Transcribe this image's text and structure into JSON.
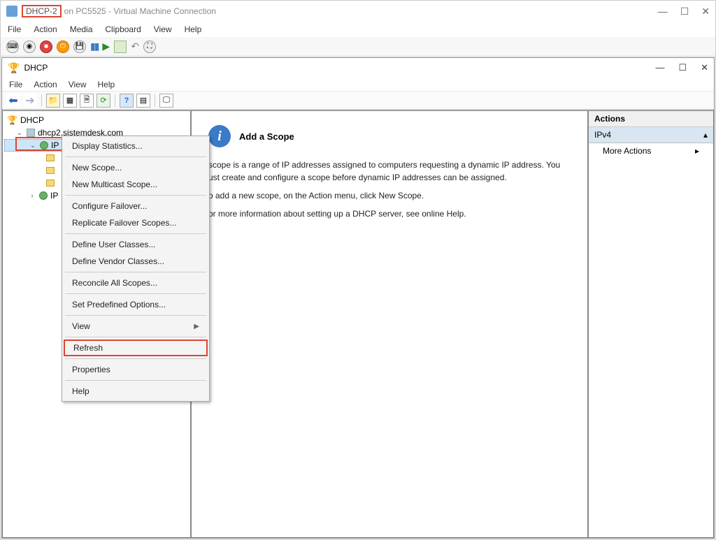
{
  "vm": {
    "title_prefix": "DHCP-2",
    "title_rest": "on PC5525 - Virtual Machine Connection",
    "menu": [
      "File",
      "Action",
      "Media",
      "Clipboard",
      "View",
      "Help"
    ]
  },
  "inner": {
    "title": "DHCP",
    "menu": [
      "File",
      "Action",
      "View",
      "Help"
    ]
  },
  "tree": {
    "root": "DHCP",
    "server": "dhcp2.sistemdesk.com",
    "node_ipv4": "IP",
    "node_ipv6": "IP"
  },
  "context_menu": {
    "items": [
      {
        "label": "Display Statistics...",
        "type": "item"
      },
      {
        "type": "sep"
      },
      {
        "label": "New Scope...",
        "type": "item"
      },
      {
        "label": "New Multicast Scope...",
        "type": "item"
      },
      {
        "type": "sep"
      },
      {
        "label": "Configure Failover...",
        "type": "item"
      },
      {
        "label": "Replicate Failover Scopes...",
        "type": "item"
      },
      {
        "type": "sep"
      },
      {
        "label": "Define User Classes...",
        "type": "item"
      },
      {
        "label": "Define Vendor Classes...",
        "type": "item"
      },
      {
        "type": "sep"
      },
      {
        "label": "Reconcile All Scopes...",
        "type": "item"
      },
      {
        "type": "sep"
      },
      {
        "label": "Set Predefined Options...",
        "type": "item"
      },
      {
        "type": "sep"
      },
      {
        "label": "View",
        "type": "submenu"
      },
      {
        "type": "sep"
      },
      {
        "label": "Refresh",
        "type": "item",
        "highlight": true
      },
      {
        "type": "sep"
      },
      {
        "label": "Properties",
        "type": "item"
      },
      {
        "type": "sep"
      },
      {
        "label": "Help",
        "type": "item"
      }
    ]
  },
  "content": {
    "heading": "Add a Scope",
    "p1": "scope is a range of IP addresses assigned to computers requesting a dynamic IP address. You ust create and configure a scope before dynamic IP addresses can be assigned.",
    "p2": "o add a new scope, on the Action menu, click New Scope.",
    "p3": "or more information about setting up a DHCP server, see online Help."
  },
  "actions": {
    "header": "Actions",
    "selected": "IPv4",
    "more": "More Actions"
  }
}
